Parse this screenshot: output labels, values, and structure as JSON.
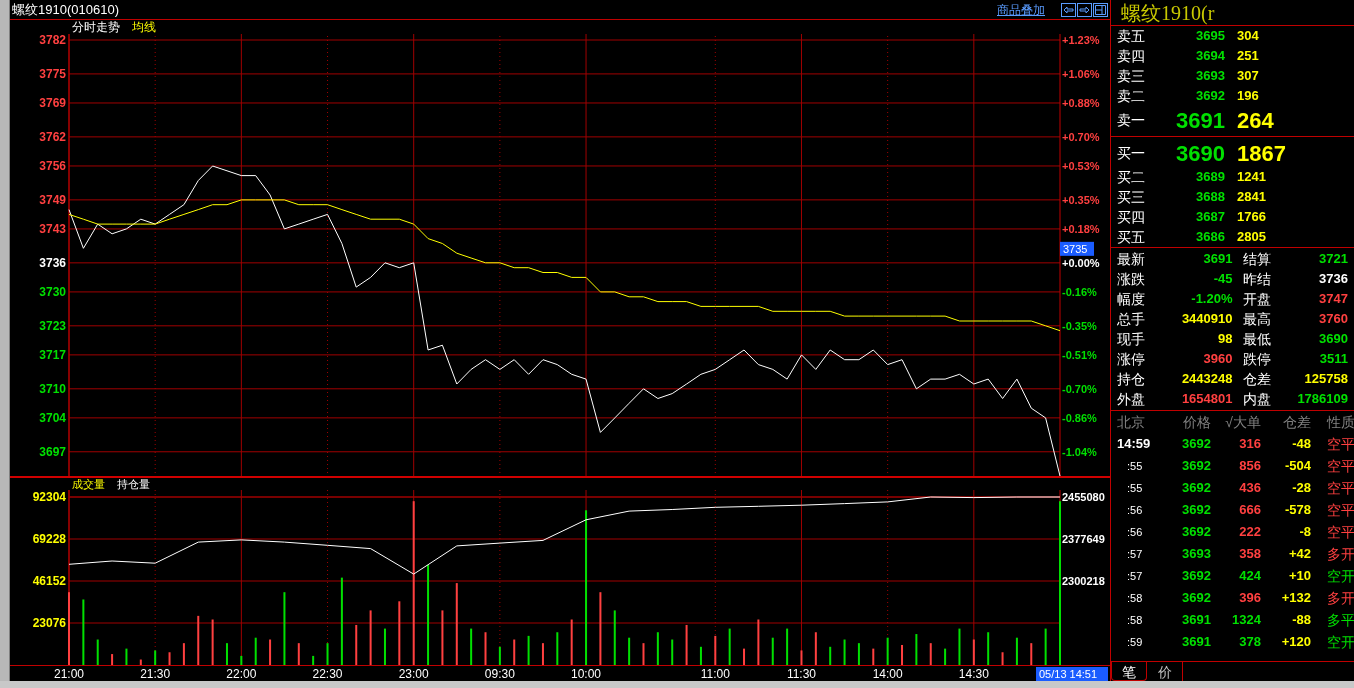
{
  "title_bar": {
    "title": "螺纹1910(010610)",
    "overlay_link": "商品叠加"
  },
  "price_panel": {
    "cursor_price": "3735",
    "right_labels": [
      {
        "label": "+1.23%",
        "color": "#ff4040"
      },
      {
        "label": "+1.06%",
        "color": "#ff4040"
      },
      {
        "label": "+0.88%",
        "color": "#ff4040"
      },
      {
        "label": "+0.70%",
        "color": "#ff4040"
      },
      {
        "label": "+0.53%",
        "color": "#ff4040"
      },
      {
        "label": "+0.35%",
        "color": "#ff4040"
      },
      {
        "label": "+0.18%",
        "color": "#ff4040"
      },
      {
        "label": "+0.00%",
        "color": "#ffffff"
      },
      {
        "label": "-0.16%",
        "color": "#00e000"
      },
      {
        "label": "-0.35%",
        "color": "#00e000"
      },
      {
        "label": "-0.51%",
        "color": "#00e000"
      },
      {
        "label": "-0.70%",
        "color": "#00e000"
      },
      {
        "label": "-0.86%",
        "color": "#00e000"
      },
      {
        "label": "-1.04%",
        "color": "#00e000"
      }
    ],
    "chart_data": {
      "type": "line",
      "grid": true,
      "ylim": [
        3692,
        3782
      ],
      "yticks": [
        3782,
        3775,
        3769,
        3762,
        3756,
        3749,
        3743,
        3736,
        3730,
        3723,
        3717,
        3710,
        3704,
        3697
      ],
      "categories": [
        null,
        null,
        null,
        null,
        null,
        null,
        null,
        null,
        null,
        null,
        null,
        null,
        null,
        null,
        null,
        null,
        null,
        null,
        null,
        null,
        null,
        null,
        null,
        null,
        null,
        null,
        null,
        null,
        null,
        null,
        null,
        null,
        null,
        null,
        null,
        null,
        null,
        null,
        null,
        null,
        null,
        null,
        null,
        null,
        null,
        null,
        null,
        null,
        null,
        null,
        null,
        null,
        null,
        null,
        null,
        null,
        null,
        null,
        null,
        null,
        null,
        null,
        null,
        null,
        null,
        null,
        null,
        null,
        null,
        null
      ],
      "series": [
        {
          "name": "分时走势",
          "color": "#ffffff",
          "values": [
            3747,
            3739,
            3744,
            3742,
            3743,
            3745,
            3744,
            3746,
            3748,
            3753,
            3756,
            3755,
            3754,
            3754,
            3750,
            3743,
            3744,
            3745,
            3746,
            3740,
            3731,
            3733,
            3736,
            3735,
            3736,
            3718,
            3719,
            3711,
            3714,
            3716,
            3714,
            3716,
            3713,
            3716,
            3715,
            3713,
            3712,
            3701,
            3704,
            3707,
            3710,
            3708,
            3709,
            3711,
            3713,
            3714,
            3716,
            3718,
            3715,
            3714,
            3712,
            3717,
            3714,
            3718,
            3716,
            3716,
            3718,
            3715,
            3716,
            3710,
            3712,
            3712,
            3713,
            3711,
            3712,
            3708,
            3712,
            3706,
            3704,
            3692
          ]
        },
        {
          "name": "均线",
          "color": "#ffff00",
          "values": [
            3746,
            3745,
            3744,
            3744,
            3744,
            3744,
            3744,
            3745,
            3746,
            3747,
            3748,
            3748,
            3749,
            3749,
            3749,
            3749,
            3748,
            3748,
            3748,
            3747,
            3746,
            3745,
            3745,
            3745,
            3744,
            3741,
            3740,
            3738,
            3737,
            3736,
            3736,
            3735,
            3735,
            3734,
            3734,
            3733,
            3733,
            3730,
            3730,
            3729,
            3729,
            3728,
            3728,
            3728,
            3727,
            3727,
            3727,
            3727,
            3727,
            3726,
            3726,
            3726,
            3726,
            3726,
            3725,
            3725,
            3725,
            3725,
            3725,
            3725,
            3725,
            3725,
            3724,
            3724,
            3724,
            3724,
            3724,
            3724,
            3723,
            3722
          ]
        }
      ]
    }
  },
  "volume_panel": {
    "volume_label": "成交量",
    "time_cursor": "05/13 14:51",
    "volume": {
      "chart_data": {
        "type": "bar",
        "stacked": true,
        "grid": true,
        "ylim": [
          0,
          92304
        ],
        "yticks": [
          92304,
          69228,
          46152,
          23076
        ],
        "categories": [
          "21:00",
          null,
          null,
          null,
          null,
          null,
          "21:30",
          null,
          null,
          null,
          null,
          null,
          "22:00",
          null,
          null,
          null,
          null,
          null,
          "22:30",
          null,
          null,
          null,
          null,
          null,
          "23:00",
          null,
          null,
          null,
          null,
          null,
          "09:30",
          null,
          null,
          null,
          null,
          null,
          "10:00",
          null,
          null,
          null,
          null,
          null,
          null,
          null,
          null,
          "11:00",
          null,
          null,
          null,
          null,
          null,
          "11:30",
          null,
          null,
          null,
          null,
          null,
          "14:00",
          null,
          null,
          null,
          null,
          null,
          "14:30",
          null,
          null,
          null,
          null,
          null,
          null
        ],
        "series": [
          {
            "color": "#ff4040",
            "values": [
              40000,
              null,
              null,
              6000,
              null,
              3000,
              null,
              7000,
              12000,
              27000,
              25000,
              null,
              null,
              null,
              14000,
              null,
              12000,
              null,
              null,
              null,
              22000,
              30000,
              null,
              35000,
              90000,
              null,
              30000,
              45000,
              null,
              18000,
              null,
              14000,
              null,
              12000,
              null,
              25000,
              null,
              40000,
              null,
              null,
              12000,
              null,
              null,
              22000,
              null,
              16000,
              null,
              9000,
              25000,
              null,
              null,
              8000,
              18000,
              null,
              null,
              null,
              9000,
              null,
              11000,
              null,
              12000,
              null,
              null,
              14000,
              null,
              7000,
              null,
              12000,
              null,
              null
            ]
          },
          {
            "color": "#00e000",
            "values": [
              null,
              36000,
              14000,
              null,
              9000,
              null,
              8000,
              null,
              null,
              null,
              null,
              12000,
              5000,
              15000,
              null,
              40000,
              null,
              5000,
              12000,
              48000,
              null,
              null,
              20000,
              null,
              null,
              55000,
              null,
              null,
              20000,
              null,
              10000,
              null,
              16000,
              null,
              18000,
              null,
              85000,
              null,
              30000,
              15000,
              null,
              18000,
              14000,
              null,
              10000,
              null,
              20000,
              null,
              null,
              15000,
              20000,
              null,
              null,
              10000,
              14000,
              12000,
              null,
              15000,
              null,
              17000,
              null,
              9000,
              20000,
              null,
              18000,
              null,
              15000,
              null,
              20000,
              90000
            ]
          }
        ]
      }
    },
    "open_interest": {
      "chart_data": {
        "type": "line",
        "ylim": [
          2145356,
          2455080
        ],
        "yticks": [
          2455080,
          2377649,
          2300218
        ],
        "categories": [
          null,
          null,
          null,
          null,
          null,
          null,
          null,
          null,
          null,
          null,
          null,
          null,
          null,
          null,
          null,
          null,
          null,
          null,
          null,
          null,
          null,
          null,
          null,
          null
        ],
        "series": [
          {
            "name": "持仓量",
            "color": "#ffffff",
            "values": [
              2331000,
              2337000,
              2333000,
              2372000,
              2376000,
              2372000,
              2366000,
              2360000,
              2313000,
              2365000,
              2370000,
              2375000,
              2413000,
              2429000,
              2432000,
              2436000,
              2438000,
              2440000,
              2443000,
              2446000,
              2455000,
              2454000,
              2455000,
              2455000
            ]
          }
        ]
      }
    }
  },
  "quote_panel": {
    "title": "螺纹1910(r",
    "asks": [
      {
        "label": "卖五",
        "price": "3695",
        "volume": "304",
        "kind": "depth"
      },
      {
        "label": "卖四",
        "price": "3694",
        "volume": "251",
        "kind": "depth"
      },
      {
        "label": "卖三",
        "price": "3693",
        "volume": "307",
        "kind": "depth"
      },
      {
        "label": "卖二",
        "price": "3692",
        "volume": "196",
        "kind": "depth"
      },
      {
        "label": "卖一",
        "price": "3691",
        "volume": "264",
        "kind": "best"
      }
    ],
    "bids": [
      {
        "label": "买一",
        "price": "3690",
        "volume": "1867",
        "kind": "best"
      },
      {
        "label": "买二",
        "price": "3689",
        "volume": "1241",
        "kind": "depth"
      },
      {
        "label": "买三",
        "price": "3688",
        "volume": "2841",
        "kind": "depth"
      },
      {
        "label": "买四",
        "price": "3687",
        "volume": "1766",
        "kind": "depth"
      },
      {
        "label": "买五",
        "price": "3686",
        "volume": "2805",
        "kind": "depth"
      }
    ],
    "stats": [
      {
        "label": "最新",
        "value": "3691",
        "color": "#00e000"
      },
      {
        "label": "结算",
        "value": "3721",
        "color": "#00e000"
      },
      {
        "label": "涨跌",
        "value": "-45",
        "color": "#00e000"
      },
      {
        "label": "昨结",
        "value": "3736",
        "color": "#ffffff"
      },
      {
        "label": "幅度",
        "value": "-1.20%",
        "color": "#00e000"
      },
      {
        "label": "开盘",
        "value": "3747",
        "color": "#ff4040"
      },
      {
        "label": "总手",
        "value": "3440910",
        "color": "#ffff00"
      },
      {
        "label": "最高",
        "value": "3760",
        "color": "#ff4040"
      },
      {
        "label": "现手",
        "value": "98",
        "color": "#ffff00"
      },
      {
        "label": "最低",
        "value": "3690",
        "color": "#00e000"
      },
      {
        "label": "涨停",
        "value": "3960",
        "color": "#ff4040"
      },
      {
        "label": "跌停",
        "value": "3511",
        "color": "#00e000"
      },
      {
        "label": "持仓",
        "value": "2443248",
        "color": "#ffff00"
      },
      {
        "label": "仓差",
        "value": "125758",
        "color": "#ffff00"
      },
      {
        "label": "外盘",
        "value": "1654801",
        "color": "#ff4040"
      },
      {
        "label": "内盘",
        "value": "1786109",
        "color": "#00e000"
      }
    ],
    "ticks_header": [
      "北京",
      "价格",
      "√大单",
      "仓差",
      "性质"
    ],
    "ticks": [
      {
        "time": "14:59",
        "price": "3692",
        "volume": "316",
        "oi_change": "-48",
        "nature": "空平",
        "color": "#ff4040"
      },
      {
        "time": ":55",
        "price": "3692",
        "volume": "856",
        "oi_change": "-504",
        "nature": "空平",
        "color": "#ff4040"
      },
      {
        "time": ":55",
        "price": "3692",
        "volume": "436",
        "oi_change": "-28",
        "nature": "空平",
        "color": "#ff4040"
      },
      {
        "time": ":56",
        "price": "3692",
        "volume": "666",
        "oi_change": "-578",
        "nature": "空平",
        "color": "#ff4040"
      },
      {
        "time": ":56",
        "price": "3692",
        "volume": "222",
        "oi_change": "-8",
        "nature": "空平",
        "color": "#ff4040"
      },
      {
        "time": ":57",
        "price": "3693",
        "volume": "358",
        "oi_change": "+42",
        "nature": "多开",
        "color": "#ff4040"
      },
      {
        "time": ":57",
        "price": "3692",
        "volume": "424",
        "oi_change": "+10",
        "nature": "空开",
        "color": "#00e000"
      },
      {
        "time": ":58",
        "price": "3692",
        "volume": "396",
        "oi_change": "+132",
        "nature": "多开",
        "color": "#ff4040"
      },
      {
        "time": ":58",
        "price": "3691",
        "volume": "1324",
        "oi_change": "-88",
        "nature": "多平",
        "color": "#00e000"
      },
      {
        "time": ":59",
        "price": "3691",
        "volume": "378",
        "oi_change": "+120",
        "nature": "空开",
        "color": "#00e000"
      }
    ],
    "tabs": [
      {
        "label": "笔",
        "selected": true
      },
      {
        "label": "价",
        "selected": false
      }
    ]
  }
}
